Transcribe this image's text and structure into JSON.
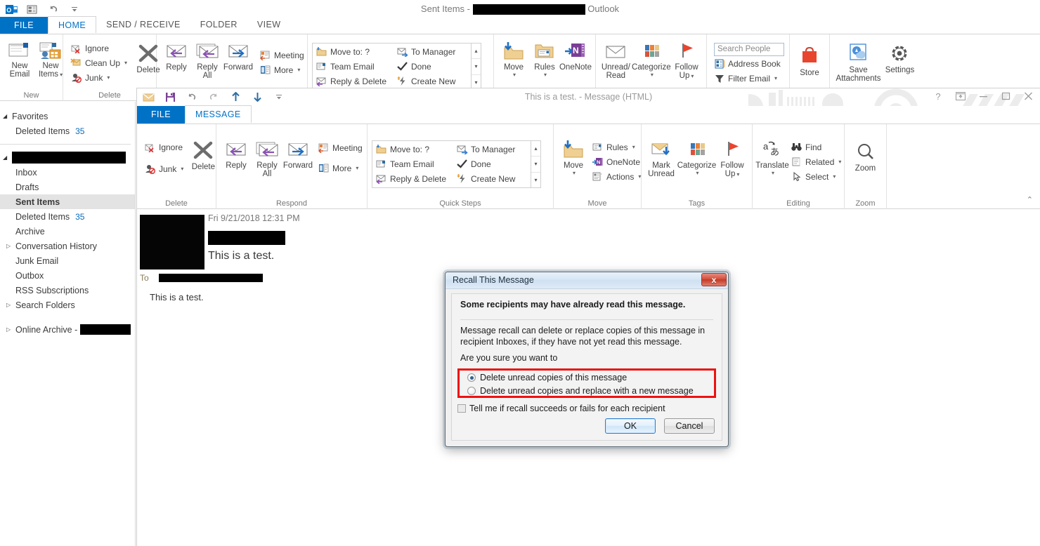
{
  "main_window": {
    "title_prefix": "Sent Items -",
    "title_suffix": "Outlook",
    "quick_access": [
      {
        "name": "outlook-logo-icon",
        "label": "Outlook"
      },
      {
        "name": "send-receive-all-icon",
        "label": "Send/Receive All Folders"
      },
      {
        "name": "undo-icon",
        "label": "Undo"
      },
      {
        "name": "customize-qat-icon",
        "label": "Customize Quick Access Toolbar"
      }
    ],
    "tabs": [
      {
        "label": "FILE",
        "active": false,
        "file": true
      },
      {
        "label": "HOME",
        "active": true,
        "file": false
      },
      {
        "label": "SEND / RECEIVE",
        "active": false,
        "file": false
      },
      {
        "label": "FOLDER",
        "active": false,
        "file": false
      },
      {
        "label": "VIEW",
        "active": false,
        "file": false
      }
    ],
    "ribbon": {
      "new_group": {
        "label": "New",
        "new_email": "New\nEmail",
        "new_email_l1": "New",
        "new_email_l2": "Email",
        "new_items_l1": "New",
        "new_items_l2": "Items"
      },
      "delete_group": {
        "label": "Delete",
        "ignore": "Ignore",
        "clean_up": "Clean Up",
        "junk": "Junk",
        "delete": "Delete"
      },
      "respond_group": {
        "reply": "Reply",
        "reply_all_l1": "Reply",
        "reply_all_l2": "All",
        "forward": "Forward",
        "meeting": "Meeting",
        "more": "More"
      },
      "quick_steps_group": {
        "move_to": "Move to: ?",
        "team_email": "Team Email",
        "reply_delete": "Reply & Delete",
        "to_manager": "To Manager",
        "done": "Done",
        "create_new": "Create New"
      },
      "move_group": {
        "move": "Move",
        "rules": "Rules",
        "onenote": "OneNote"
      },
      "tags_group": {
        "unread_read_l1": "Unread/",
        "unread_read_l2": "Read",
        "categorize": "Categorize",
        "follow_up_l1": "Follow",
        "follow_up_l2": "Up"
      },
      "find_group": {
        "search_people_placeholder": "Search People",
        "address_book": "Address Book",
        "filter_email": "Filter Email"
      },
      "store_group": {
        "store": "Store"
      },
      "addins_group": {
        "save_attachments_l1": "Save",
        "save_attachments_l2": "Attachments",
        "settings": "Settings"
      }
    }
  },
  "nav_pane": {
    "favorites_label": "Favorites",
    "favorites_items": [
      {
        "label": "Deleted Items",
        "count": "35"
      }
    ],
    "account_redacted": true,
    "account_items": [
      {
        "label": "Inbox",
        "count": "",
        "arrow": false,
        "selected": false
      },
      {
        "label": "Drafts",
        "count": "",
        "arrow": false,
        "selected": false
      },
      {
        "label": "Sent Items",
        "count": "",
        "arrow": false,
        "selected": true
      },
      {
        "label": "Deleted Items",
        "count": "35",
        "arrow": false,
        "selected": false
      },
      {
        "label": "Archive",
        "count": "",
        "arrow": false,
        "selected": false
      },
      {
        "label": "Conversation History",
        "count": "",
        "arrow": true,
        "selected": false
      },
      {
        "label": "Junk Email",
        "count": "",
        "arrow": false,
        "selected": false
      },
      {
        "label": "Outbox",
        "count": "",
        "arrow": false,
        "selected": false
      },
      {
        "label": "RSS Subscriptions",
        "count": "",
        "arrow": false,
        "selected": false
      },
      {
        "label": "Search Folders",
        "count": "",
        "arrow": true,
        "selected": false
      }
    ],
    "online_archive_label": "Online Archive -"
  },
  "message_window": {
    "title": "This is a test. - Message (HTML)",
    "quick_access": [
      {
        "name": "envelope-icon"
      },
      {
        "name": "save-icon"
      },
      {
        "name": "undo-icon"
      },
      {
        "name": "redo-icon"
      },
      {
        "name": "previous-item-icon"
      },
      {
        "name": "next-item-icon"
      },
      {
        "name": "customize-qat-icon"
      }
    ],
    "window_controls": [
      {
        "name": "help-icon",
        "glyph": "?"
      },
      {
        "name": "ribbon-display-options-icon",
        "glyph": ""
      },
      {
        "name": "minimize-icon",
        "glyph": "–"
      },
      {
        "name": "maximize-icon",
        "glyph": "□"
      },
      {
        "name": "close-icon",
        "glyph": "✕"
      }
    ],
    "tabs": [
      {
        "label": "FILE",
        "active": false,
        "file": true
      },
      {
        "label": "MESSAGE",
        "active": true,
        "file": false
      }
    ],
    "ribbon": {
      "delete_group": {
        "label": "Delete",
        "ignore": "Ignore",
        "junk": "Junk",
        "delete": "Delete"
      },
      "respond_group": {
        "label": "Respond",
        "reply": "Reply",
        "reply_all_l1": "Reply",
        "reply_all_l2": "All",
        "forward": "Forward",
        "meeting": "Meeting",
        "more": "More"
      },
      "quick_steps_group": {
        "label": "Quick Steps",
        "move_to": "Move to: ?",
        "team_email": "Team Email",
        "reply_delete": "Reply & Delete",
        "to_manager": "To Manager",
        "done": "Done",
        "create_new": "Create New"
      },
      "move_group": {
        "label": "Move",
        "move": "Move",
        "rules": "Rules",
        "onenote": "OneNote",
        "actions": "Actions"
      },
      "tags_group": {
        "label": "Tags",
        "mark_unread_l1": "Mark",
        "mark_unread_l2": "Unread",
        "categorize": "Categorize",
        "follow_up_l1": "Follow",
        "follow_up_l2": "Up"
      },
      "editing_group": {
        "label": "Editing",
        "translate": "Translate",
        "find": "Find",
        "related": "Related",
        "select": "Select"
      },
      "zoom_group": {
        "label": "Zoom",
        "zoom": "Zoom"
      }
    },
    "header": {
      "date": "Fri 9/21/2018 12:31 PM",
      "subject": "This is a test.",
      "to_label": "To"
    },
    "body": "This is a test."
  },
  "recall_dialog": {
    "title": "Recall This Message",
    "close_glyph": "x",
    "warning": "Some recipients may have already read this message.",
    "description": "Message recall can delete or replace copies of this message in recipient Inboxes, if they have not yet read this message.",
    "question": "Are you sure you want to",
    "options": [
      {
        "label": "Delete unread copies of this message",
        "checked": true
      },
      {
        "label": "Delete unread copies and replace with a new message",
        "checked": false
      }
    ],
    "checkbox_label": "Tell me if recall succeeds or fails for each recipient",
    "checkbox_checked": false,
    "ok_label": "OK",
    "cancel_label": "Cancel",
    "highlight_color": "#ee1111"
  }
}
